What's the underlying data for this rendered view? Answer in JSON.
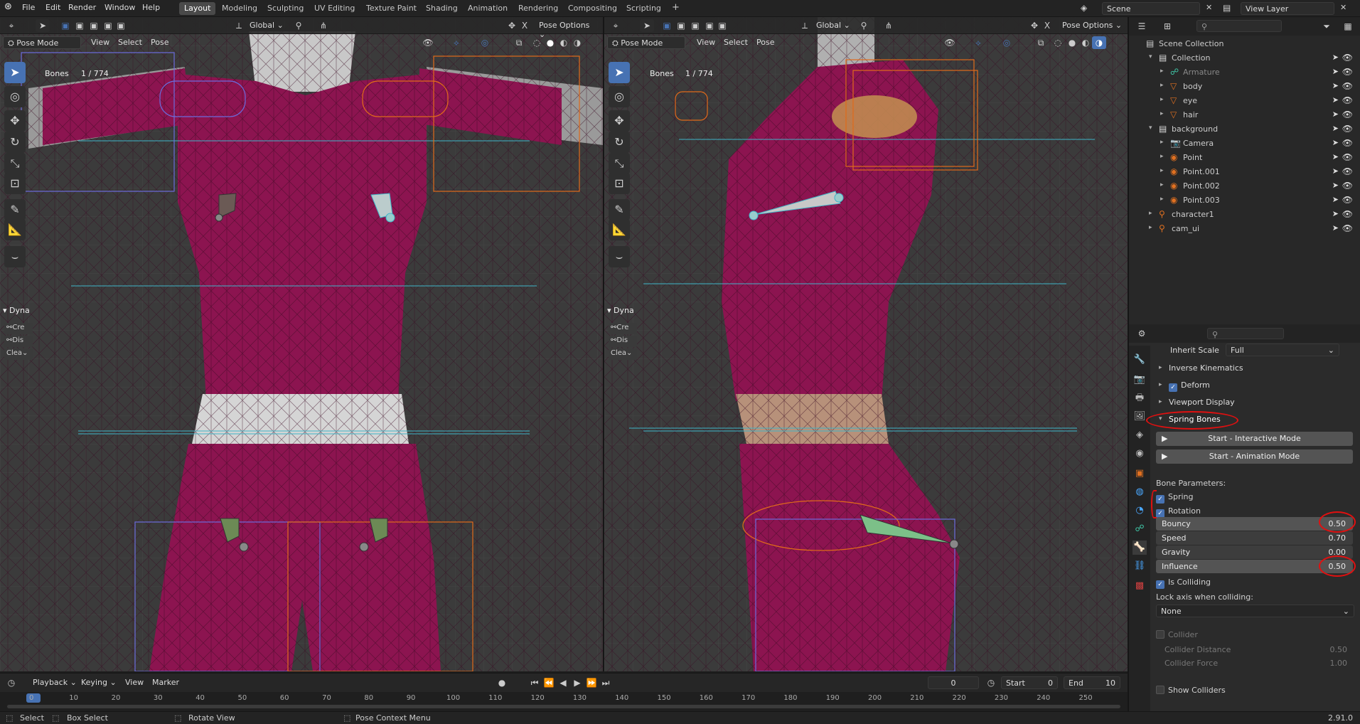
{
  "menu": [
    "File",
    "Edit",
    "Render",
    "Window",
    "Help"
  ],
  "workspaces": [
    "Layout",
    "Modeling",
    "Sculpting",
    "UV Editing",
    "Texture Paint",
    "Shading",
    "Animation",
    "Rendering",
    "Compositing",
    "Scripting"
  ],
  "scene": {
    "label": "Scene",
    "view_layer": "View Layer"
  },
  "viewport_left": {
    "mode": "Pose Mode",
    "menus": [
      "View",
      "Select",
      "Pose"
    ],
    "orientation": "Global",
    "pose_options": "Pose Options",
    "bones_label": "Bones",
    "bones_count": "1 / 774",
    "dyna_title": "Dyna",
    "dyna_buttons": [
      "Cre",
      "Dis",
      "Clea"
    ]
  },
  "viewport_right": {
    "mode": "Pose Mode",
    "menus": [
      "View",
      "Select",
      "Pose"
    ],
    "orientation": "Global",
    "pose_options": "Pose Options",
    "bones_label": "Bones",
    "bones_count": "1 / 774",
    "dyna_title": "Dyna",
    "dyna_buttons": [
      "Cre",
      "Dis",
      "Clea"
    ]
  },
  "outliner": {
    "root": "Scene Collection",
    "rows": [
      {
        "label": "Collection",
        "icon": "collection-icon",
        "indent": 1
      },
      {
        "label": "Armature",
        "icon": "armature-icon",
        "indent": 2,
        "dim": true
      },
      {
        "label": "body",
        "icon": "mesh-icon",
        "indent": 2
      },
      {
        "label": "eye",
        "icon": "mesh-icon",
        "indent": 2
      },
      {
        "label": "hair",
        "icon": "mesh-icon",
        "indent": 2
      },
      {
        "label": "background",
        "icon": "collection-icon",
        "indent": 1
      },
      {
        "label": "Camera",
        "icon": "camera-icon",
        "indent": 2
      },
      {
        "label": "Point",
        "icon": "light-icon",
        "indent": 2
      },
      {
        "label": "Point.001",
        "icon": "light-icon",
        "indent": 2
      },
      {
        "label": "Point.002",
        "icon": "light-icon",
        "indent": 2
      },
      {
        "label": "Point.003",
        "icon": "light-icon",
        "indent": 2
      },
      {
        "label": "character1",
        "icon": "object-icon",
        "indent": 1
      },
      {
        "label": "cam_ui",
        "icon": "object-icon",
        "indent": 1
      }
    ]
  },
  "properties": {
    "inherit_scale_label": "Inherit Scale",
    "inherit_scale_value": "Full",
    "sections": [
      "Inverse Kinematics",
      "Deform",
      "Viewport Display",
      "Spring Bones"
    ],
    "start_interactive": "Start - Interactive Mode",
    "start_animation": "Start - Animation Mode",
    "bone_params": "Bone Parameters:",
    "spring": "Spring",
    "rotation": "Rotation",
    "sliders": [
      {
        "label": "Bouncy",
        "value": "0.50"
      },
      {
        "label": "Speed",
        "value": "0.70"
      },
      {
        "label": "Gravity",
        "value": "0.00"
      },
      {
        "label": "Influence",
        "value": "0.50"
      }
    ],
    "is_colliding": "Is Colliding",
    "lock_axis_label": "Lock axis when colliding:",
    "lock_axis_value": "None",
    "collider": "Collider",
    "collider_distance": {
      "label": "Collider Distance",
      "value": "0.50"
    },
    "collider_force": {
      "label": "Collider Force",
      "value": "1.00"
    },
    "show_colliders": "Show Colliders"
  },
  "timeline": {
    "menus": [
      "Playback",
      "Keying",
      "View",
      "Marker"
    ],
    "current_frame": "0",
    "start_label": "Start",
    "start": "0",
    "end_label": "End",
    "end": "10",
    "ruler": [
      "0",
      "10",
      "20",
      "30",
      "40",
      "50",
      "60",
      "70",
      "80",
      "90",
      "100",
      "110",
      "120",
      "130",
      "140",
      "150",
      "160",
      "170",
      "180",
      "190",
      "200",
      "210",
      "220",
      "230",
      "240",
      "250"
    ]
  },
  "statusbar": {
    "select": "Select",
    "box_select": "Box Select",
    "rotate_view": "Rotate View",
    "pose_context": "Pose Context Menu",
    "version": "2.91.0"
  },
  "colors": {
    "accent": "#4772b3",
    "body": "#8c1450",
    "annotation": "#e01010"
  }
}
